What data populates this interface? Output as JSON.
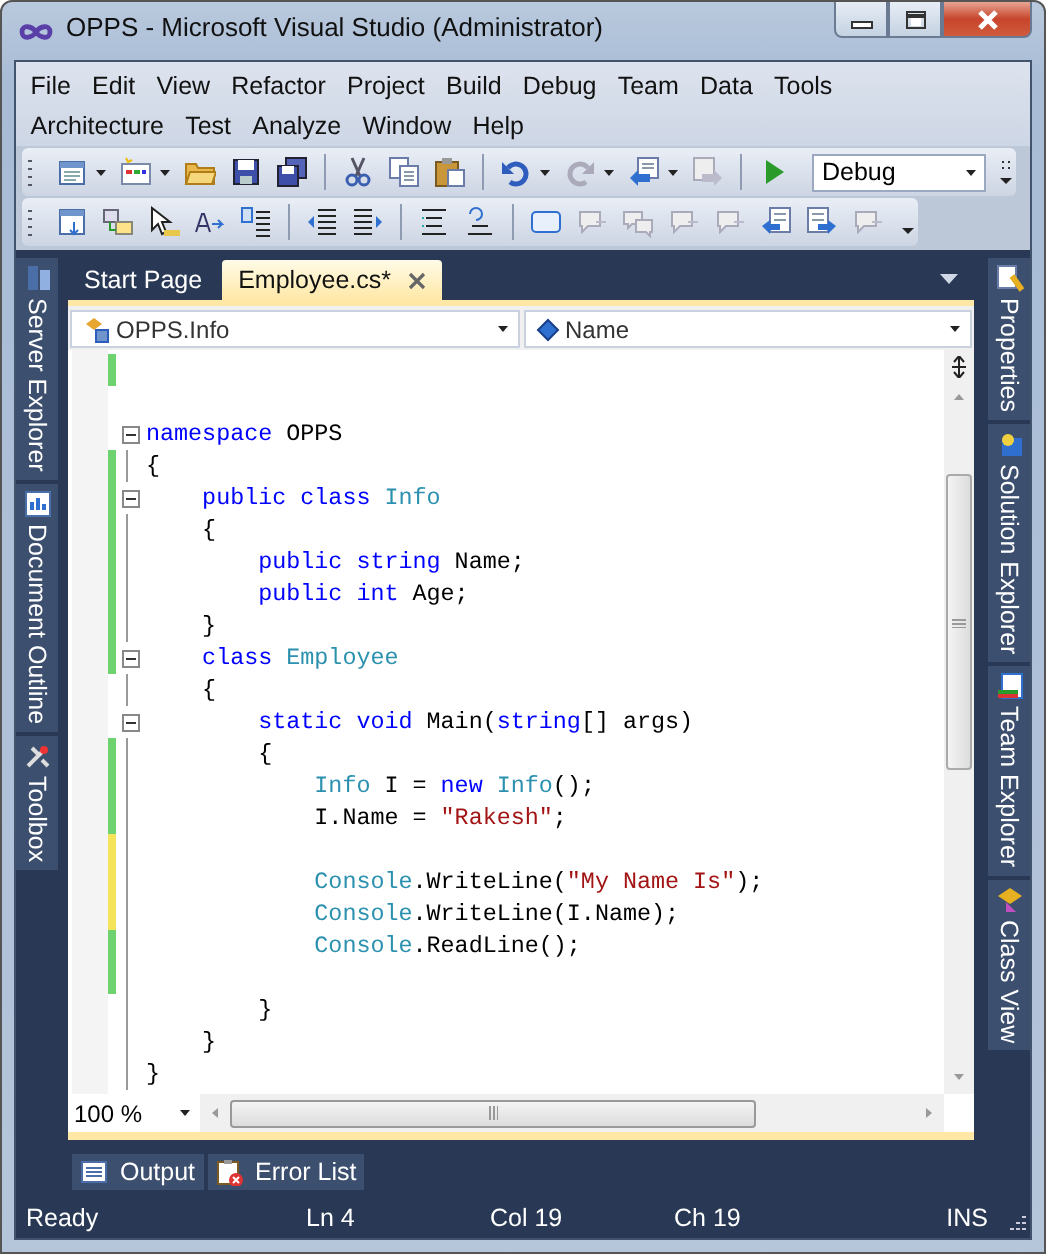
{
  "window": {
    "title": "OPPS - Microsoft Visual Studio (Administrator)"
  },
  "menu_rows": [
    {
      "items": [
        "File",
        "Edit",
        "View",
        "Refactor",
        "Project",
        "Build",
        "Debug",
        "Team",
        "Data",
        "Tools"
      ]
    },
    {
      "items": [
        "Architecture",
        "Test",
        "Analyze",
        "Window",
        "Help"
      ]
    }
  ],
  "configuration": {
    "value": "Debug"
  },
  "left_panels": [
    "Server Explorer",
    "Document Outline",
    "Toolbox"
  ],
  "right_panels": [
    "Properties",
    "Solution Explorer",
    "Team Explorer",
    "Class View"
  ],
  "tabs": [
    {
      "label": "Start Page",
      "selected": false
    },
    {
      "label": "Employee.cs*",
      "selected": true
    }
  ],
  "navigation_bar": {
    "types": "OPPS.Info",
    "members": "Name"
  },
  "code_lines": [
    {
      "color": "#6ed36e"
    },
    {
      "expanded": true,
      "segments": [
        {
          "text": "namespace",
          "kind": "keyword"
        },
        {
          "text": " OPPS",
          "kind": "plain"
        }
      ]
    },
    {
      "color": "#6ed36e",
      "segments": [
        {
          "text": "{",
          "kind": "plain"
        }
      ]
    },
    {
      "color": "#6ed36e",
      "expanded": true,
      "segments": [
        {
          "text": "    public class",
          "kind": "keyword"
        },
        {
          "text": " Info",
          "kind": "type"
        }
      ]
    },
    {
      "color": "#6ed36e",
      "segments": [
        {
          "text": "    {",
          "kind": "plain"
        }
      ]
    },
    {
      "color": "#6ed36e",
      "segments": [
        {
          "text": "        public string",
          "kind": "keyword"
        },
        {
          "text": " Name;",
          "kind": "plain"
        }
      ]
    },
    {
      "color": "#6ed36e",
      "segments": [
        {
          "text": "        public int",
          "kind": "keyword"
        },
        {
          "text": " Age;",
          "kind": "plain"
        }
      ]
    },
    {
      "color": "#6ed36e",
      "segments": [
        {
          "text": "    }",
          "kind": "plain"
        }
      ]
    },
    {
      "color": "#6ed36e",
      "expanded": true,
      "segments": [
        {
          "text": "    class",
          "kind": "keyword"
        },
        {
          "text": " Employee",
          "kind": "type"
        }
      ]
    },
    {
      "segments": [
        {
          "text": "    {",
          "kind": "plain"
        }
      ]
    },
    {
      "expanded": true,
      "segments": [
        {
          "text": "        static void",
          "kind": "keyword"
        },
        {
          "text": " Main(",
          "kind": "plain"
        },
        {
          "text": "string",
          "kind": "keyword"
        },
        {
          "text": "[] args)",
          "kind": "plain"
        }
      ]
    },
    {
      "color": "#6ed36e",
      "segments": [
        {
          "text": "        {",
          "kind": "plain"
        }
      ]
    },
    {
      "color": "#6ed36e",
      "segments": [
        {
          "text": "            Info",
          "kind": "type"
        },
        {
          "text": " I = ",
          "kind": "plain"
        },
        {
          "text": "new",
          "kind": "keyword"
        },
        {
          "text": " Info",
          "kind": "type"
        },
        {
          "text": "();",
          "kind": "plain"
        }
      ]
    },
    {
      "color": "#6ed36e",
      "segments": [
        {
          "text": "            I.Name = ",
          "kind": "plain"
        },
        {
          "text": "\"Rakesh\"",
          "kind": "string"
        },
        {
          "text": ";",
          "kind": "plain"
        }
      ]
    },
    {
      "color": "#f4e45a"
    },
    {
      "color": "#f4e45a",
      "segments": [
        {
          "text": "            Console",
          "kind": "type"
        },
        {
          "text": ".WriteLine(",
          "kind": "plain"
        },
        {
          "text": "\"My Name Is\"",
          "kind": "string"
        },
        {
          "text": ");",
          "kind": "plain"
        }
      ]
    },
    {
      "color": "#f4e45a",
      "segments": [
        {
          "text": "            Console",
          "kind": "type"
        },
        {
          "text": ".WriteLine(I.Name);",
          "kind": "plain"
        }
      ]
    },
    {
      "color": "#6ed36e",
      "segments": [
        {
          "text": "            Console",
          "kind": "type"
        },
        {
          "text": ".ReadLine();",
          "kind": "plain"
        }
      ]
    },
    {
      "color": "#6ed36e"
    },
    {
      "segments": [
        {
          "text": "        }",
          "kind": "plain"
        }
      ]
    },
    {
      "segments": [
        {
          "text": "    }",
          "kind": "plain"
        }
      ]
    },
    {
      "segments": [
        {
          "text": "}",
          "kind": "plain"
        }
      ]
    }
  ],
  "zoom": {
    "value": "100 %"
  },
  "bottom_panels": [
    "Output",
    "Error List"
  ],
  "status_bar": {
    "message": "Ready",
    "line": "Ln 4",
    "column": "Col 19",
    "char": "Ch 19",
    "mode": "INS"
  }
}
